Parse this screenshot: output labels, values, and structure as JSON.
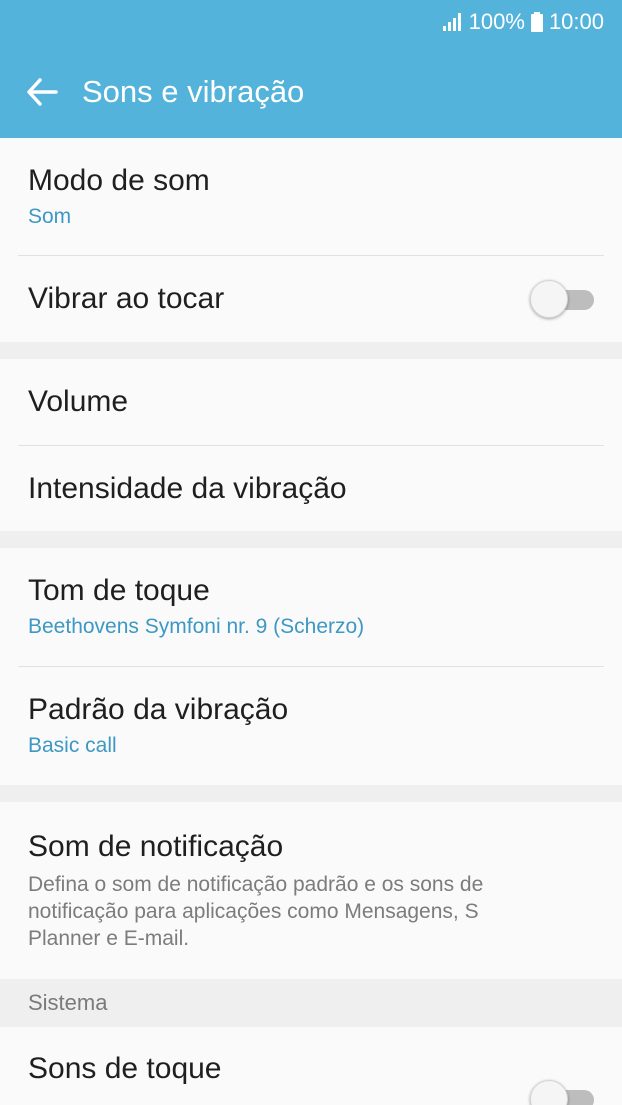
{
  "status_bar": {
    "battery_text": "100%",
    "time": "10:00",
    "icons": [
      "signal-icon",
      "battery-icon"
    ]
  },
  "app_bar": {
    "title": "Sons e vibração",
    "back_icon": "arrow-left-icon"
  },
  "settings": {
    "sound_mode": {
      "title": "Modo de som",
      "value": "Som"
    },
    "vibrate_on_touch": {
      "title": "Vibrar ao tocar",
      "enabled": false
    },
    "volume": {
      "title": "Volume"
    },
    "vibration_intensity": {
      "title": "Intensidade da vibração"
    },
    "ringtone": {
      "title": "Tom de toque",
      "value": "Beethovens Symfoni nr. 9 (Scherzo)"
    },
    "vibration_pattern": {
      "title": "Padrão da vibração",
      "value": "Basic call"
    },
    "notification_sound": {
      "title": "Som de notificação",
      "description": "Defina o som de notificação padrão e os sons de notificação para aplicações como Mensagens, S Planner e E-mail."
    },
    "system_section": {
      "label": "Sistema"
    },
    "touch_sounds": {
      "title": "Sons de toque",
      "enabled": false
    }
  },
  "colors": {
    "header": "#54b3da",
    "accent_text": "#3d98c4",
    "background": "#fafafa",
    "separator": "#efefef"
  }
}
